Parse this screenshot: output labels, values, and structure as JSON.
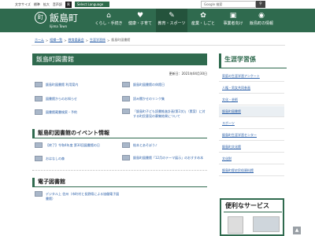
{
  "utility": {
    "text_size": "文字サイズ",
    "standard": "標準",
    "large": "拡大",
    "read_aloud": "音声読",
    "black": "黒",
    "language": "Select Language",
    "search_placeholder": "Google 検索"
  },
  "header": {
    "logo_mark": "町",
    "logo_text": "飯島町",
    "logo_sub": "Iijima Town",
    "nav": [
      {
        "icon": "⌂",
        "label": "くらし・手続き"
      },
      {
        "icon": "♥",
        "label": "健康・子育て"
      },
      {
        "icon": "✎",
        "label": "教育・スポーツ"
      },
      {
        "icon": "✿",
        "label": "産業・しごと"
      },
      {
        "icon": "▣",
        "label": "事業者向け"
      },
      {
        "icon": "◉",
        "label": "飯島町の情報"
      }
    ]
  },
  "breadcrumb": [
    "ホーム",
    "組織一覧",
    "教育委員会",
    "生涯学習係",
    "飯島町図書館"
  ],
  "main": {
    "title": "飯島町図書館",
    "updated": "更新日：2021年04月30日",
    "links_left": [
      "飯島町図書館 利用案内",
      "図書館からのお知らせ",
      "図書館蔵書検索・予約"
    ],
    "links_right": [
      "飯島町図書館の休館日",
      "読み聞かせのリンク集",
      "「飯島町子ども読書推進計画(第2次)」（素案）に対する町民意見の募集結果について"
    ],
    "events_heading": "飯島町図書館のイベント情報",
    "events_left": [
      "【終了】令和4年度 第30回図書館の日",
      "おはなしの森"
    ],
    "events_right": [
      "絵本とあそぼう♪",
      "飯島町図書館「12月のテーマ展示」のおすすめ本"
    ],
    "ebook_heading": "電子図書館",
    "ebook_links": [
      "デジタル上 信州（市町村と長野県による協働電子図書館）"
    ]
  },
  "sidebar": {
    "title": "生涯学習係",
    "items": [
      "家庭の生涯学習アンケート",
      "人権・男女共同参画",
      "文化・芸術",
      "飯島町図書館",
      "スポーツ",
      "飯島町生涯学習センター",
      "飯島町文化館",
      "文化財",
      "飯島町歴史民俗資料館"
    ],
    "current_index": 3
  },
  "service": {
    "title": "便利なサービス"
  }
}
